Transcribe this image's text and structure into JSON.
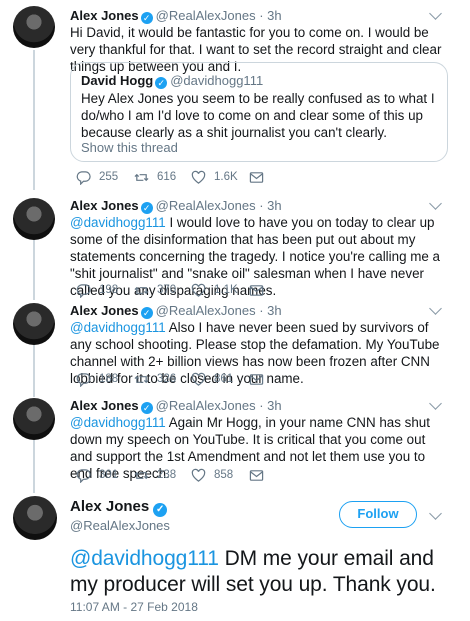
{
  "tweets": [
    {
      "name": "Alex Jones",
      "handle": "@RealAlexJones",
      "time": "· 3h",
      "mention": "",
      "text": "Hi David, it would be fantastic for you to come on. I would be very thankful for that. I want to set the record straight and clear things up between you and I.",
      "quote": {
        "name": "David Hogg",
        "handle": "@davidhogg111",
        "text": "Hey Alex Jones you seem to be really confused as to what I do/who I am I'd love to come on and clear some of this up because clearly as a shit journalist you can't clearly.",
        "link": "Show this thread"
      },
      "replies": "255",
      "retweets": "616",
      "likes": "1.6K"
    },
    {
      "name": "Alex Jones",
      "handle": "@RealAlexJones",
      "time": "· 3h",
      "mention": "@davidhogg111",
      "text": " I would love to have you on today to clear up some of the disinformation that has been put out about my statements concerning the tragedy. I notice you're calling me a \"shit journalist\" and \"snake oil\" salesman when I have never called you any disparaging names.",
      "replies": "198",
      "retweets": "370",
      "likes": "1.1K"
    },
    {
      "name": "Alex Jones",
      "handle": "@RealAlexJones",
      "time": "· 3h",
      "mention": "@davidhogg111",
      "text": " Also I have never been sued by survivors of any school shooting. Please stop the defamation. My YouTube channel with 2+ billion views has now been frozen after CNN lobbied for it to be closed in your name.",
      "replies": "188",
      "retweets": "326",
      "likes": "861"
    },
    {
      "name": "Alex Jones",
      "handle": "@RealAlexJones",
      "time": "· 3h",
      "mention": "@davidhogg111",
      "text": " Again Mr Hogg, in your name CNN has shut down my speech on YouTube. It is critical that you come out and support the 1st Amendment and not let them use you to end free speech.",
      "replies": "301",
      "retweets": "238",
      "likes": "858"
    }
  ],
  "main": {
    "name": "Alex Jones",
    "handle": "@RealAlexJones",
    "follow_label": "Follow",
    "mention": "@davidhogg111",
    "text": " DM me your email and my producer will set you up. Thank you.",
    "timestamp": "11:07 AM - 27 Feb 2018"
  },
  "icons": {
    "verified": "check",
    "reply": "reply-icon",
    "retweet": "retweet-icon",
    "like": "heart-icon",
    "dm": "envelope-icon"
  },
  "colors": {
    "accent": "#1da1f2",
    "mention": "#1b95e0",
    "muted": "#657786"
  }
}
